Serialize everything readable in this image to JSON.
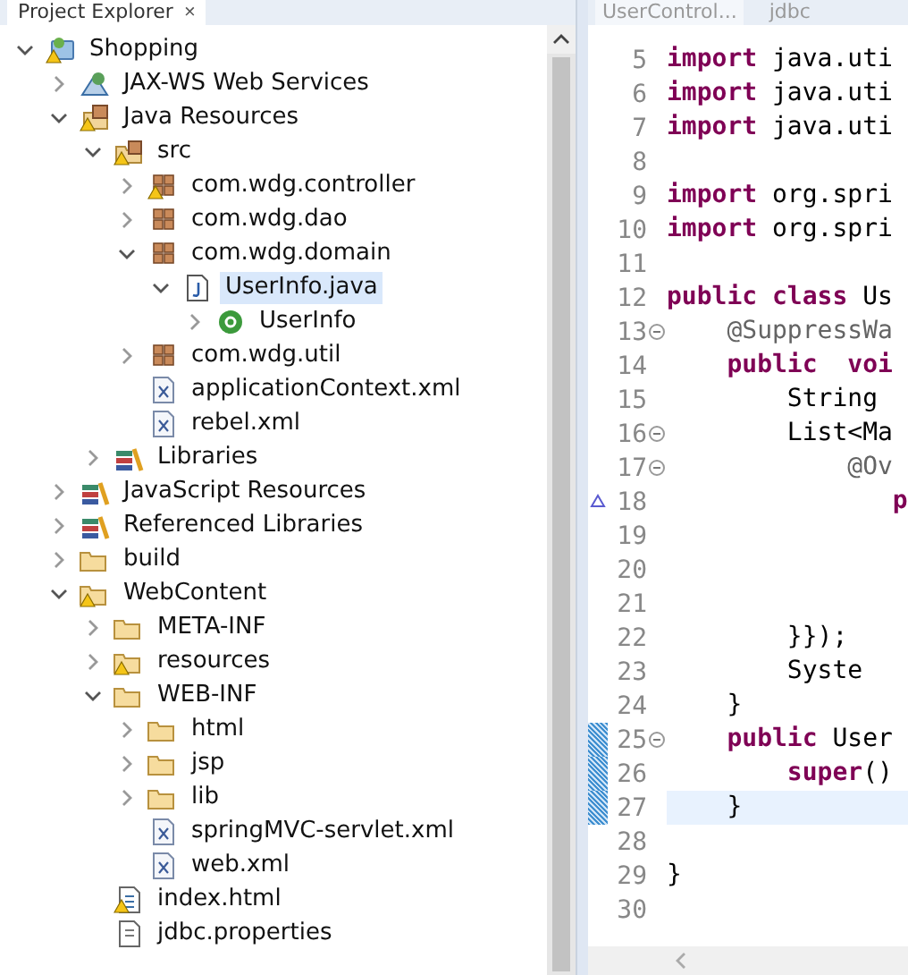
{
  "explorer": {
    "title": "Project Explorer",
    "close": "×"
  },
  "tree": [
    {
      "label": "Shopping",
      "kind": "project",
      "warning": true,
      "expanded": true,
      "selected": false,
      "children": [
        {
          "label": "JAX-WS Web Services",
          "kind": "webservice",
          "warning": false,
          "expanded": false,
          "selected": false
        },
        {
          "label": "Java Resources",
          "kind": "javaresources",
          "warning": true,
          "expanded": true,
          "selected": false,
          "children": [
            {
              "label": "src",
              "kind": "sourcefolder",
              "warning": true,
              "expanded": true,
              "selected": false,
              "children": [
                {
                  "label": "com.wdg.controller",
                  "kind": "package",
                  "warning": true,
                  "expanded": false,
                  "selected": false
                },
                {
                  "label": "com.wdg.dao",
                  "kind": "package",
                  "warning": false,
                  "expanded": false,
                  "selected": false
                },
                {
                  "label": "com.wdg.domain",
                  "kind": "package",
                  "warning": false,
                  "expanded": true,
                  "selected": false,
                  "children": [
                    {
                      "label": "UserInfo.java",
                      "kind": "javafile",
                      "warning": false,
                      "expanded": true,
                      "selected": true,
                      "children": [
                        {
                          "label": "UserInfo",
                          "kind": "class",
                          "warning": false,
                          "expanded": false,
                          "selected": false
                        }
                      ]
                    }
                  ]
                },
                {
                  "label": "com.wdg.util",
                  "kind": "package",
                  "warning": false,
                  "expanded": false,
                  "selected": false
                },
                {
                  "label": "applicationContext.xml",
                  "kind": "xml",
                  "warning": false,
                  "selected": false
                },
                {
                  "label": "rebel.xml",
                  "kind": "xml",
                  "warning": false,
                  "selected": false
                }
              ]
            },
            {
              "label": "Libraries",
              "kind": "library",
              "warning": false,
              "expanded": false,
              "selected": false
            }
          ]
        },
        {
          "label": "JavaScript Resources",
          "kind": "library",
          "warning": false,
          "expanded": false,
          "selected": false
        },
        {
          "label": "Referenced Libraries",
          "kind": "library",
          "warning": false,
          "expanded": false,
          "selected": false
        },
        {
          "label": "build",
          "kind": "folder",
          "warning": false,
          "expanded": false,
          "selected": false
        },
        {
          "label": "WebContent",
          "kind": "folder",
          "warning": true,
          "expanded": true,
          "selected": false,
          "children": [
            {
              "label": "META-INF",
              "kind": "folder",
              "warning": false,
              "expanded": false,
              "selected": false
            },
            {
              "label": "resources",
              "kind": "folder",
              "warning": true,
              "expanded": false,
              "selected": false
            },
            {
              "label": "WEB-INF",
              "kind": "folder",
              "warning": false,
              "expanded": true,
              "selected": false,
              "children": [
                {
                  "label": "html",
                  "kind": "folder",
                  "warning": false,
                  "expanded": false,
                  "selected": false
                },
                {
                  "label": "jsp",
                  "kind": "folder",
                  "warning": false,
                  "expanded": false,
                  "selected": false
                },
                {
                  "label": "lib",
                  "kind": "folder",
                  "warning": false,
                  "expanded": false,
                  "selected": false
                },
                {
                  "label": "springMVC-servlet.xml",
                  "kind": "xml",
                  "warning": false,
                  "selected": false
                },
                {
                  "label": "web.xml",
                  "kind": "xml",
                  "warning": false,
                  "selected": false
                }
              ]
            },
            {
              "label": "index.html",
              "kind": "html",
              "warning": true,
              "selected": false
            },
            {
              "label": "jdbc.properties",
              "kind": "properties",
              "warning": false,
              "selected": false
            }
          ]
        }
      ]
    }
  ],
  "editor_tabs": [
    {
      "label": "UserControl...",
      "selected": true
    },
    {
      "label": "jdbc",
      "selected": false
    }
  ],
  "code": [
    {
      "num": "5",
      "fold": false,
      "override": false,
      "changed": false,
      "current": false,
      "tokens": [
        {
          "kind": "keyword",
          "text": "import"
        },
        {
          "kind": "plain",
          "text": " java.uti"
        }
      ]
    },
    {
      "num": "6",
      "fold": false,
      "override": false,
      "changed": false,
      "current": false,
      "tokens": [
        {
          "kind": "keyword",
          "text": "import"
        },
        {
          "kind": "plain",
          "text": " java.uti"
        }
      ]
    },
    {
      "num": "7",
      "fold": false,
      "override": false,
      "changed": false,
      "current": false,
      "tokens": [
        {
          "kind": "keyword",
          "text": "import"
        },
        {
          "kind": "plain",
          "text": " java.uti"
        }
      ]
    },
    {
      "num": "8",
      "fold": false,
      "override": false,
      "changed": false,
      "current": false
    },
    {
      "num": "9",
      "fold": false,
      "override": false,
      "changed": false,
      "current": false,
      "tokens": [
        {
          "kind": "keyword",
          "text": "import"
        },
        {
          "kind": "plain",
          "text": " org.spri"
        }
      ]
    },
    {
      "num": "10",
      "fold": false,
      "override": false,
      "changed": false,
      "current": false,
      "tokens": [
        {
          "kind": "keyword",
          "text": "import"
        },
        {
          "kind": "plain",
          "text": " org.spri"
        }
      ]
    },
    {
      "num": "11",
      "fold": false,
      "override": false,
      "changed": false,
      "current": false
    },
    {
      "num": "12",
      "fold": false,
      "override": false,
      "changed": false,
      "current": false,
      "tokens": [
        {
          "kind": "keyword",
          "text": "public class"
        },
        {
          "kind": "plain",
          "text": " Us"
        }
      ]
    },
    {
      "num": "13",
      "fold": true,
      "override": false,
      "changed": false,
      "current": false,
      "tokens": [
        {
          "kind": "annotation",
          "text": "    @SuppressWa"
        }
      ]
    },
    {
      "num": "14",
      "fold": false,
      "override": false,
      "changed": false,
      "current": false,
      "tokens": [
        {
          "kind": "keyword",
          "text": "    public  voi"
        }
      ]
    },
    {
      "num": "15",
      "fold": false,
      "override": false,
      "changed": false,
      "current": false,
      "tokens": [
        {
          "kind": "plain",
          "text": "        String"
        }
      ]
    },
    {
      "num": "16",
      "fold": true,
      "override": false,
      "changed": false,
      "current": false,
      "tokens": [
        {
          "kind": "plain",
          "text": "        List<Ma"
        }
      ]
    },
    {
      "num": "17",
      "fold": true,
      "override": false,
      "changed": false,
      "current": false,
      "tokens": [
        {
          "kind": "annotation",
          "text": "            @Ov"
        }
      ]
    },
    {
      "num": "18",
      "fold": false,
      "override": true,
      "changed": false,
      "current": false,
      "tokens": [
        {
          "kind": "keyword",
          "text": "               p"
        }
      ]
    },
    {
      "num": "19",
      "fold": false,
      "override": false,
      "changed": false,
      "current": false
    },
    {
      "num": "20",
      "fold": false,
      "override": false,
      "changed": false,
      "current": false
    },
    {
      "num": "21",
      "fold": false,
      "override": false,
      "changed": false,
      "current": false
    },
    {
      "num": "22",
      "fold": false,
      "override": false,
      "changed": false,
      "current": false,
      "tokens": [
        {
          "kind": "plain",
          "text": "        }});"
        }
      ]
    },
    {
      "num": "23",
      "fold": false,
      "override": false,
      "changed": false,
      "current": false,
      "tokens": [
        {
          "kind": "plain",
          "text": "        Syste"
        }
      ]
    },
    {
      "num": "24",
      "fold": false,
      "override": false,
      "changed": false,
      "current": false,
      "tokens": [
        {
          "kind": "plain",
          "text": "    }"
        }
      ]
    },
    {
      "num": "25",
      "fold": true,
      "override": false,
      "changed": true,
      "current": false,
      "tokens": [
        {
          "kind": "keyword",
          "text": "    public"
        },
        {
          "kind": "plain",
          "text": " User"
        }
      ]
    },
    {
      "num": "26",
      "fold": false,
      "override": false,
      "changed": true,
      "current": false,
      "tokens": [
        {
          "kind": "keyword",
          "text": "        super"
        },
        {
          "kind": "plain",
          "text": "()"
        }
      ]
    },
    {
      "num": "27",
      "fold": false,
      "override": false,
      "changed": true,
      "current": true,
      "tokens": [
        {
          "kind": "plain",
          "text": "    }"
        }
      ]
    },
    {
      "num": "28",
      "fold": false,
      "override": false,
      "changed": false,
      "current": false
    },
    {
      "num": "29",
      "fold": false,
      "override": false,
      "changed": false,
      "current": false,
      "tokens": [
        {
          "kind": "plain",
          "text": "}"
        }
      ]
    },
    {
      "num": "30",
      "fold": false,
      "override": false,
      "changed": false,
      "current": false
    }
  ]
}
